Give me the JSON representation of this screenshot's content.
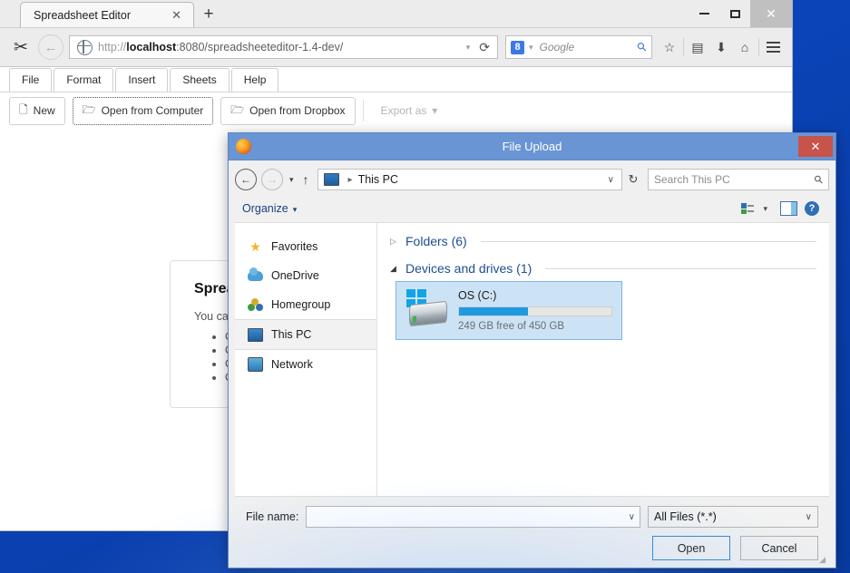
{
  "browser": {
    "window_controls": {
      "minimize": "–",
      "maximize": "❐",
      "close": "✕"
    },
    "tab": {
      "title": "Spreadsheet Editor",
      "close": "✕"
    },
    "new_tab": "+",
    "cut_icon": "✂",
    "back_arrow": "←",
    "url": {
      "scheme": "http://",
      "host": "localhost",
      "path": ":8080/spreadsheeteditor-1.4-dev/"
    },
    "url_dropdown": "▾",
    "reload": "⟳",
    "search": {
      "engine_badge": "8",
      "engine_caret": "▾",
      "placeholder": "Google",
      "icon": "⚲"
    },
    "toolbar_icons": {
      "bookmark": "☆",
      "reader": "▤",
      "downloads": "⬇",
      "home": "⌂",
      "menu": "≡"
    }
  },
  "app": {
    "menu": [
      "File",
      "Format",
      "Insert",
      "Sheets",
      "Help"
    ],
    "toolbar": [
      {
        "label": "New",
        "icon": "🗋"
      },
      {
        "label": "Open from Computer",
        "icon": "🗁"
      },
      {
        "label": "Open from Dropbox",
        "icon": "🗁"
      },
      {
        "label": "Export as",
        "icon": "▾"
      }
    ],
    "card": {
      "title": "Spreadsheet Editor",
      "intro": "You can ...",
      "bullets": [
        "C",
        "O",
        "O",
        "O"
      ]
    }
  },
  "dialog": {
    "title": "File Upload",
    "close": "✕",
    "nav": {
      "back": "←",
      "forward": "→",
      "history_caret": "▾",
      "up": "↑",
      "breadcrumb_sep": "▸",
      "breadcrumb": "This PC",
      "breadcrumb_caret": "∨",
      "refresh": "↻"
    },
    "search": {
      "placeholder": "Search This PC",
      "icon": "⚲"
    },
    "command_bar": {
      "organize": "Organize",
      "organize_caret": "▾",
      "view_caret": "▾",
      "help": "?"
    },
    "sidebar": [
      {
        "label": "Favorites",
        "icon": "star-icon"
      },
      {
        "label": "OneDrive",
        "icon": "cloud-icon"
      },
      {
        "label": "Homegroup",
        "icon": "homegroup-icon"
      },
      {
        "label": "This PC",
        "icon": "computer-icon",
        "selected": true
      },
      {
        "label": "Network",
        "icon": "network-icon"
      }
    ],
    "groups": [
      {
        "title": "Folders (6)",
        "expanded": false,
        "caret": "▷"
      },
      {
        "title": "Devices and drives (1)",
        "expanded": true,
        "caret": "◢"
      }
    ],
    "drive": {
      "name": "OS (C:)",
      "free_text": "249 GB free of 450 GB",
      "used_percent": 45,
      "bar_color": "#1e9ae0"
    },
    "footer": {
      "file_name_label": "File name:",
      "file_name_value": "",
      "file_name_caret": "∨",
      "filter_value": "All Files (*.*)",
      "filter_caret": "∨",
      "open_button": "Open",
      "cancel_button": "Cancel"
    }
  },
  "colors": {
    "desktop": "#0a46bb",
    "dialog_titlebar": "#6a95d4",
    "dialog_close": "#c7534b",
    "drive_bar": "#1e9ae0",
    "group_title": "#1d4f91",
    "organize_link": "#1b3f80"
  }
}
